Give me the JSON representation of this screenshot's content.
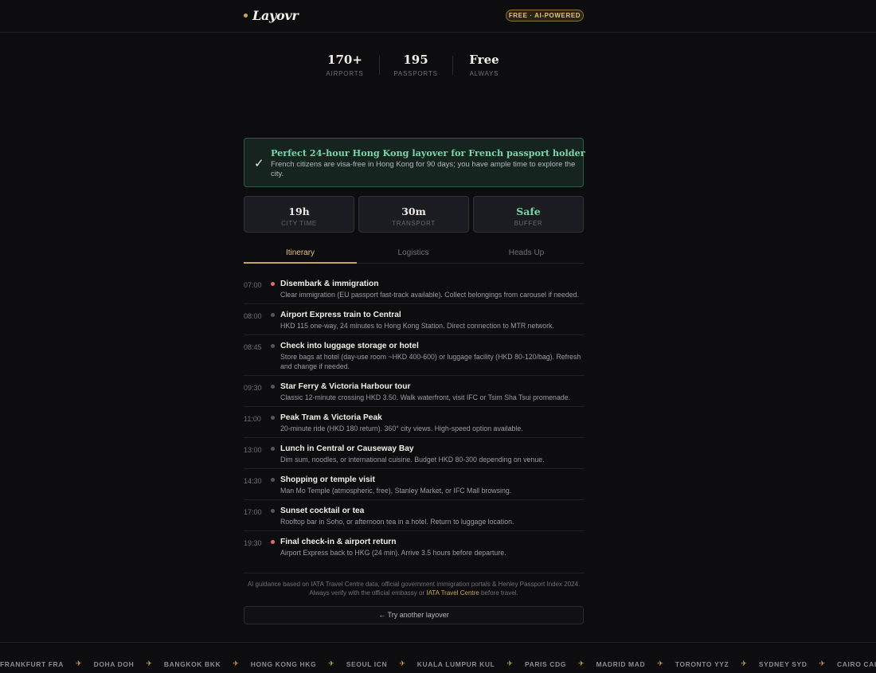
{
  "header": {
    "logo": "Layovr",
    "badge": "FREE · AI-POWERED"
  },
  "stats": [
    {
      "value": "170+",
      "label": "AIRPORTS"
    },
    {
      "value": "195",
      "label": "PASSPORTS"
    },
    {
      "value": "Free",
      "label": "ALWAYS"
    }
  ],
  "verdict": {
    "check": "✓",
    "title": "Perfect 24-hour Hong Kong layover for French passport holder",
    "subtitle": "French citizens are visa-free in Hong Kong for 90 days; you have ample time to explore the city."
  },
  "metrics": [
    {
      "value": "19h",
      "label": "CITY TIME"
    },
    {
      "value": "30m",
      "label": "TRANSPORT"
    },
    {
      "value": "Safe",
      "label": "BUFFER"
    }
  ],
  "tabs": [
    "Itinerary",
    "Logistics",
    "Heads Up"
  ],
  "itinerary": [
    {
      "time": "07:00",
      "title": "Disembark & immigration",
      "desc": "Clear immigration (EU passport fast-track available). Collect belongings from carousel if needed.",
      "highlight": true
    },
    {
      "time": "08:00",
      "title": "Airport Express train to Central",
      "desc": "HKD 115 one-way, 24 minutes to Hong Kong Station. Direct connection to MTR network.",
      "highlight": false
    },
    {
      "time": "08:45",
      "title": "Check into luggage storage or hotel",
      "desc": "Store bags at hotel (day-use room ~HKD 400-600) or luggage facility (HKD 80-120/bag). Refresh and change if needed.",
      "highlight": false
    },
    {
      "time": "09:30",
      "title": "Star Ferry & Victoria Harbour tour",
      "desc": "Classic 12-minute crossing HKD 3.50. Walk waterfront, visit IFC or Tsim Sha Tsui promenade.",
      "highlight": false
    },
    {
      "time": "11:00",
      "title": "Peak Tram & Victoria Peak",
      "desc": "20-minute ride (HKD 180 return). 360° city views. High-speed option available.",
      "highlight": false
    },
    {
      "time": "13:00",
      "title": "Lunch in Central or Causeway Bay",
      "desc": "Dim sum, noodles, or international cuisine. Budget HKD 80-300 depending on venue.",
      "highlight": false
    },
    {
      "time": "14:30",
      "title": "Shopping or temple visit",
      "desc": "Man Mo Temple (atmospheric, free), Stanley Market, or IFC Mall browsing.",
      "highlight": false
    },
    {
      "time": "17:00",
      "title": "Sunset cocktail or tea",
      "desc": "Rooftop bar in Soho, or afternoon tea in a hotel. Return to luggage location.",
      "highlight": false
    },
    {
      "time": "19:30",
      "title": "Final check-in & airport return",
      "desc": "Airport Express back to HKG (24 min). Arrive 3.5 hours before departure.",
      "highlight": true
    }
  ],
  "footnote": {
    "line1": "AI guidance based on IATA Travel Centre data, official government immigration portals & Henley Passport Index 2024.",
    "line2_pre": "Always verify with the official embassy or ",
    "link": "IATA Travel Centre",
    "line2_post": " before travel."
  },
  "try_button": "← Try another layover",
  "ticker": [
    "FRANKFURT FRA",
    "DOHA DOH",
    "BANGKOK BKK",
    "HONG KONG HKG",
    "SEOUL ICN",
    "KUALA LUMPUR KUL",
    "PARIS CDG",
    "MADRID MAD",
    "TORONTO YYZ",
    "SYDNEY SYD",
    "CAIRO CAI"
  ],
  "ticker_icon": "plane-icon",
  "colors": {
    "accent": "#c9a45a",
    "success": "#79d6a6",
    "alert": "#e36a6a",
    "background": "#0d0d10"
  }
}
